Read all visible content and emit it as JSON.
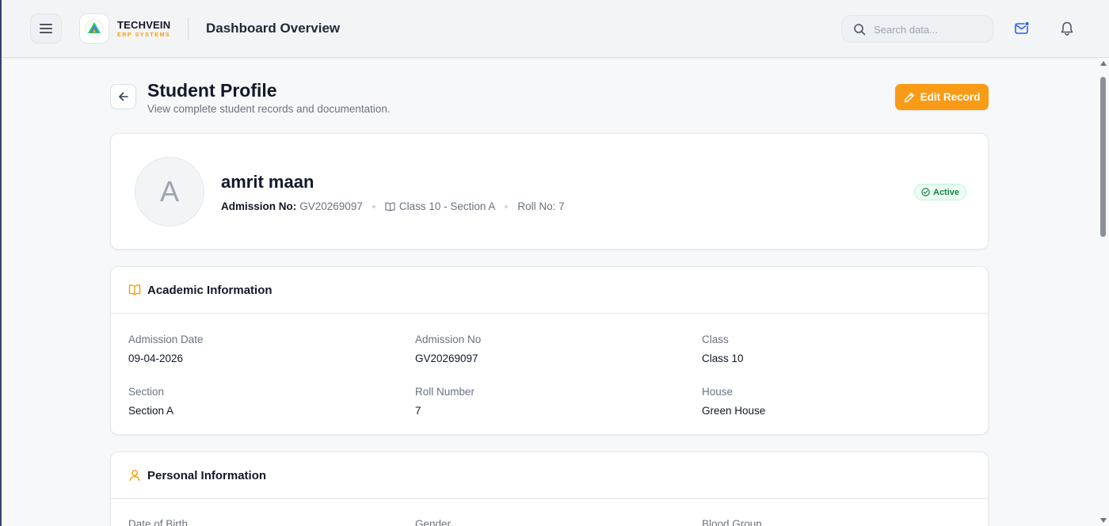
{
  "header": {
    "brand_name": "TECHVEIN",
    "brand_sub": "ERP SYSTEMS",
    "page_heading": "Dashboard Overview",
    "search_placeholder": "Search data...",
    "icons": [
      "menu-icon",
      "logo-icon",
      "search-icon",
      "mail-icon",
      "bell-icon"
    ]
  },
  "page": {
    "title": "Student Profile",
    "subtitle": "View complete student records and documentation.",
    "edit_label": "Edit Record"
  },
  "profile": {
    "avatar_initial": "A",
    "name": "amrit maan",
    "admission_label": "Admission No:",
    "admission_no": "GV20269097",
    "class_section": "Class 10 - Section A",
    "roll": "Roll No: 7",
    "status": "Active"
  },
  "academic": {
    "title": "Academic Information",
    "fields": [
      {
        "label": "Admission Date",
        "value": "09-04-2026"
      },
      {
        "label": "Admission No",
        "value": "GV20269097"
      },
      {
        "label": "Class",
        "value": "Class 10"
      },
      {
        "label": "Section",
        "value": "Section A"
      },
      {
        "label": "Roll Number",
        "value": "7"
      },
      {
        "label": "House",
        "value": "Green House"
      }
    ]
  },
  "personal": {
    "title": "Personal Information",
    "fields": [
      {
        "label": "Date of Birth"
      },
      {
        "label": "Gender"
      },
      {
        "label": "Blood Group"
      }
    ]
  },
  "colors": {
    "accent": "#f99b16",
    "status_green": "#15803d",
    "brand_orange": "#f59e0b"
  }
}
